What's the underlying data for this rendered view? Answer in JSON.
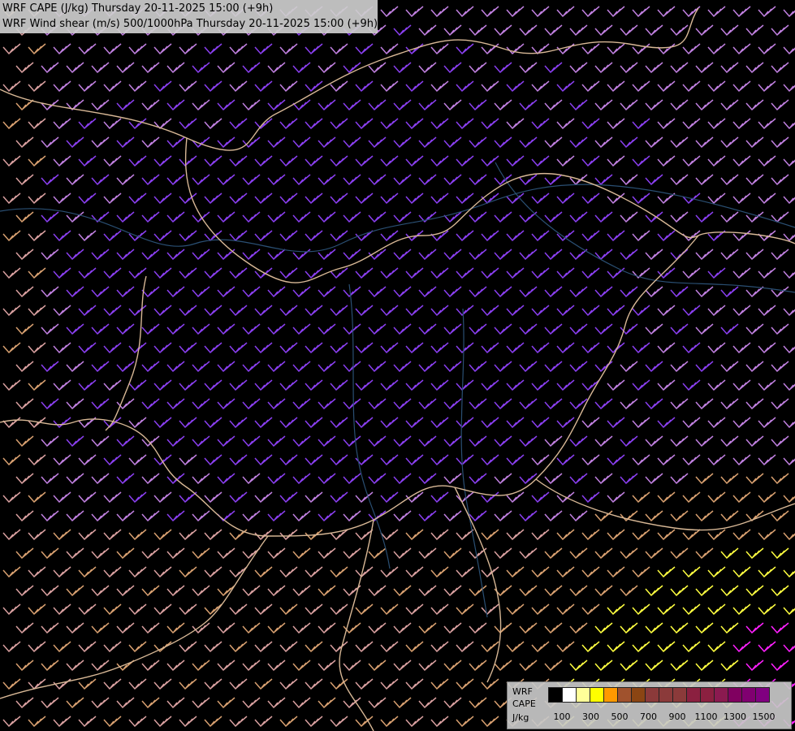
{
  "title": {
    "line1": "WRF CAPE (J/kg) Thursday 20-11-2025 15:00 (+9h)",
    "line2": "WRF Wind shear (m/s) 500/1000hPa Thursday 20-11-2025 15:00 (+9h)"
  },
  "legend": {
    "label1": "WRF",
    "label2": "CAPE",
    "label3": "J/kg",
    "colors": [
      "#000000",
      "#ffffff",
      "#ffff99",
      "#ffff00",
      "#ff9900",
      "#a0522d",
      "#8b4513",
      "#8b3a3a",
      "#8b3a3a",
      "#8b3a3a",
      "#8b2040",
      "#8b2040",
      "#8b1a50",
      "#800060",
      "#800070",
      "#800080"
    ],
    "ticks": [
      "100",
      "300",
      "500",
      "700",
      "900",
      "1100",
      "1300",
      "1500"
    ]
  },
  "colors": {
    "background": "#000000",
    "border": "#d8b896",
    "river": "#2a4f73",
    "barb_strong": "#8a3ff0",
    "barb_medium": "#c080e0",
    "barb_light": "#d9a0a0",
    "barb_tan": "#d8a070",
    "barb_yellow": "#ffff40",
    "barb_magenta": "#ff20ff"
  }
}
